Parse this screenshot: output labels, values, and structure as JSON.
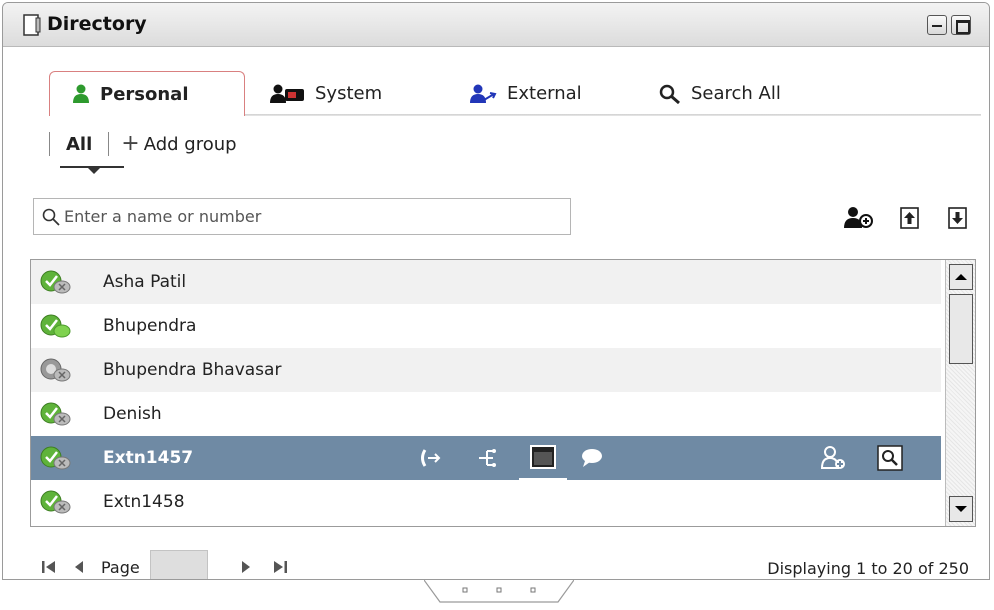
{
  "window": {
    "title": "Directory"
  },
  "tabs": {
    "personal": "Personal",
    "system": "System",
    "external": "External",
    "search_all": "Search All"
  },
  "groups": {
    "all": "All",
    "add_group": "Add group"
  },
  "search": {
    "placeholder": "Enter a name or number",
    "value": ""
  },
  "contacts": [
    {
      "name": "Asha Patil",
      "status": "available-offline-chat",
      "selected": false
    },
    {
      "name": "Bhupendra",
      "status": "available-chat",
      "selected": false
    },
    {
      "name": "Bhupendra Bhavasar",
      "status": "unavailable",
      "selected": false
    },
    {
      "name": "Denish",
      "status": "available-offline-chat",
      "selected": false
    },
    {
      "name": "Extn1457",
      "status": "available-offline-chat",
      "selected": true
    },
    {
      "name": "Extn1458",
      "status": "available-offline-chat",
      "selected": false
    }
  ],
  "pagination": {
    "page_label": "Page",
    "page_value": "",
    "display_info": "Displaying 1 to 20 of 250"
  },
  "colors": {
    "selected_row": "#6f8aa4",
    "available": "#5fb33a",
    "active_tab_border": "#d98080"
  }
}
